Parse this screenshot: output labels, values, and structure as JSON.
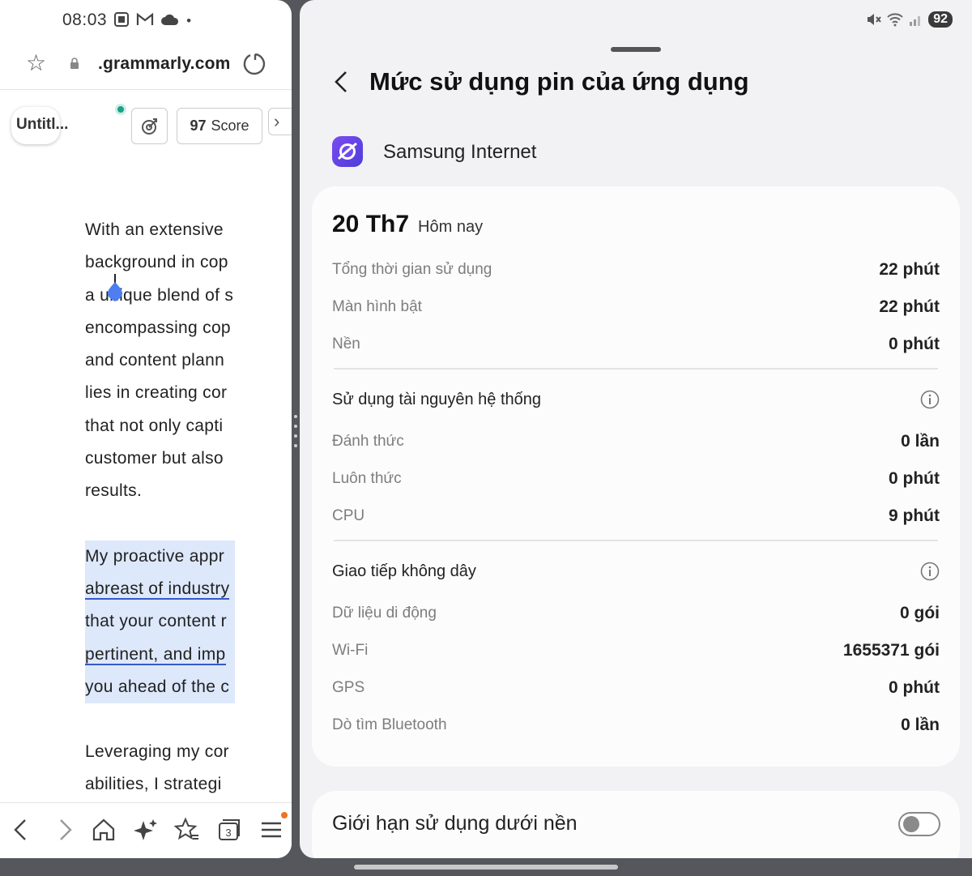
{
  "browser": {
    "status": {
      "time": "08:03"
    },
    "url": ".grammarly.com",
    "doc_title": "Untitl...",
    "score": {
      "value": "97",
      "label": "Score"
    },
    "paragraphs": [
      [
        "With an extensive",
        "background in cop",
        "a unique blend of s",
        "encompassing cop",
        "and content plann",
        "lies in creating cor",
        "that not only capti",
        "customer but also",
        "results."
      ],
      [
        "My proactive appr",
        "abreast of industry",
        "that your content r",
        "pertinent, and imp",
        "you ahead of the c"
      ],
      [
        "Leveraging my cor",
        "abilities, I strategi"
      ]
    ],
    "bottom_nav": {
      "tabs_count": "3"
    }
  },
  "settings": {
    "status": {
      "battery": "92"
    },
    "title": "Mức sử dụng pin của ứng dụng",
    "app_name": "Samsung Internet",
    "date": {
      "day": "20 Th7",
      "label": "Hôm nay"
    },
    "usage": [
      {
        "label": "Tổng thời gian sử dụng",
        "value": "22 phút"
      },
      {
        "label": "Màn hình bật",
        "value": "22 phút"
      },
      {
        "label": "Nền",
        "value": "0 phút"
      }
    ],
    "system": {
      "title": "Sử dụng tài nguyên hệ thống",
      "rows": [
        {
          "label": "Đánh thức",
          "value": "0 lần"
        },
        {
          "label": "Luôn thức",
          "value": "0 phút"
        },
        {
          "label": "CPU",
          "value": "9 phút"
        }
      ]
    },
    "wireless": {
      "title": "Giao tiếp không dây",
      "rows": [
        {
          "label": "Dữ liệu di động",
          "value": "0 gói"
        },
        {
          "label": "Wi-Fi",
          "value": "1655371 gói"
        },
        {
          "label": "GPS",
          "value": "0 phút"
        },
        {
          "label": "Dò tìm Bluetooth",
          "value": "0 lần"
        }
      ]
    },
    "background_limit": {
      "label": "Giới hạn sử dụng dưới nền",
      "enabled": false
    }
  }
}
